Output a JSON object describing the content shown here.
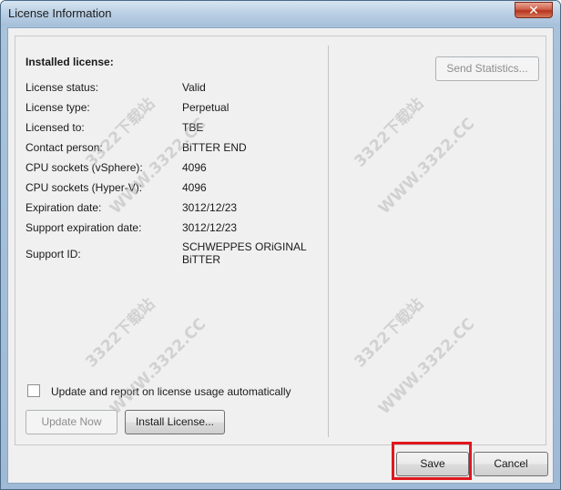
{
  "window": {
    "title": "License Information",
    "close_glyph": "✕"
  },
  "license": {
    "heading": "Installed license:",
    "rows": [
      {
        "label": "License status:",
        "value": "Valid"
      },
      {
        "label": "License type:",
        "value": "Perpetual"
      },
      {
        "label": "Licensed to:",
        "value": "TBE"
      },
      {
        "label": "Contact person:",
        "value": "BiTTER END"
      },
      {
        "label": "CPU sockets (vSphere):",
        "value": "4096"
      },
      {
        "label": "CPU sockets (Hyper-V):",
        "value": "4096"
      },
      {
        "label": "Expiration date:",
        "value": "3012/12/23"
      },
      {
        "label": "Support expiration date:",
        "value": "3012/12/23"
      },
      {
        "label": "Support ID:",
        "value": "SCHWEPPES ORiGINAL BiTTER"
      }
    ]
  },
  "options": {
    "auto_report_label": "Update and report on license usage automatically",
    "auto_report_checked": false
  },
  "buttons": {
    "update_now": "Update Now",
    "install_license": "Install License...",
    "send_statistics": "Send Statistics...",
    "save": "Save",
    "cancel": "Cancel"
  },
  "watermark": {
    "line1": "3322下载站",
    "line2": "WWW.3322.CC"
  },
  "colors": {
    "highlight": "#e0161e",
    "close_button": "#c9452d",
    "title_bar": "#b9cfe4"
  }
}
